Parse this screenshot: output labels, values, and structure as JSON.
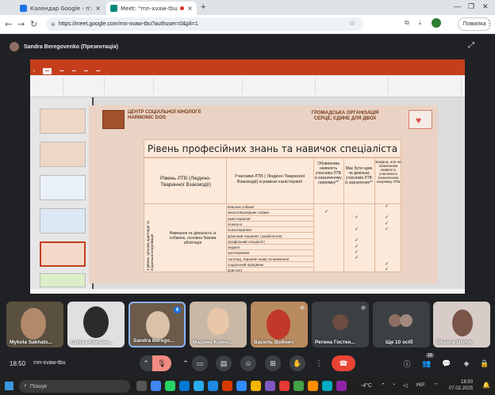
{
  "browser": {
    "tabs": [
      {
        "label": "Календар Google - пʼятниця, 7",
        "close": "×"
      },
      {
        "label": "Meet: \"rnn-xvaw-tbu\"",
        "close": "×"
      }
    ],
    "new_tab": "+",
    "url": "https://meet.google.com/rnn-xvaw-tbu?authuser=0&pli=1",
    "error_button": "Помилка"
  },
  "presenter_bar": {
    "label": "Sandra Beregovenko (Презентація)"
  },
  "slide": {
    "org_left": [
      "ЦЕНТР СОЦІАЛЬНОЇ КІНОЛОГІЇ",
      "HARMONIC DOG"
    ],
    "org_right": [
      "ГРОМАДСЬКА ОРГАНІЗАЦІЯ",
      "СЕРЦЕ, ЄДИНЕ ДЛЯ ДВОХ"
    ],
    "title": "Рівень професійних знань та навичок спеціаліста",
    "col_headers": [
      "Рівень ЛТВ (Людино-Тваринної Взаємодії)",
      "Учасники ЛТВ ( Людино-Тваринної Взаємодії) в рамках каністерапії",
      "Обовязкова наявність учасника ЛТВ в зазначеному напрямку**",
      "Має бути один чи декілька учасників ЛТВ із зазначених**",
      "Бажана, але не обовязкова наявність учасника в зазначеному напрямку ЛТВ"
    ],
    "level_text": "Навчання та діяльність із собакою, основна базова абілітація",
    "side_text": "3 рівень: цільова адаптація та подальша комунікація",
    "rows": [
      "власник собаки*",
      "кінолог/провідник собаки",
      "каністерапевт",
      "психолог",
      "психотерапевт",
      "фізичний терапевт / реабілітолог",
      "профільний спеціаліст",
      "педагог",
      "ерготерапевт",
      "логопед, терапевт мови та мовлення",
      "соціальний працівник",
      "асистент"
    ],
    "check": "✓"
  },
  "participants": [
    {
      "name": "Mykola Sakhats..."
    },
    {
      "name": "Larysa Afanase..."
    },
    {
      "name": "Sandra Berego..."
    },
    {
      "name": "Марина Комін..."
    },
    {
      "name": "Василь Войнич"
    },
    {
      "name": "Регина Гостен..."
    },
    {
      "name": "Ще 10 осіб"
    },
    {
      "name": "Oksana Olinyk"
    }
  ],
  "meet": {
    "time": "18:50",
    "code": "rnn-xvaw-tbu",
    "participant_count": "19"
  },
  "taskbar": {
    "search": "Пошук",
    "weather": "-4°C",
    "lang": "УКР",
    "time": "18:50",
    "date": "07.02.2025"
  }
}
